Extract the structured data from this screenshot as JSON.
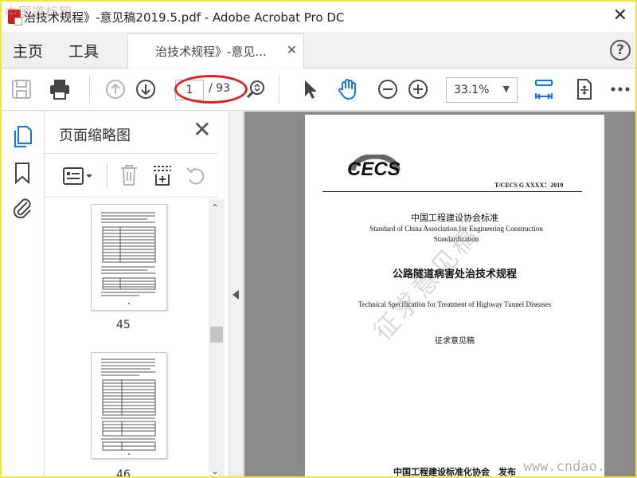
{
  "window": {
    "title": "治技术规程》-意见稿2019.5.pdf - Adobe Acrobat Pro DC",
    "close_glyph": "✕",
    "watermark_tl": "中国道标网"
  },
  "menu": {
    "home": "主页",
    "tools": "工具",
    "doc_tab_label": "治技术规程》-意见...",
    "doc_tab_close": "✕",
    "help": "?"
  },
  "toolbar": {
    "page_current": "1",
    "page_total": "/ 93",
    "zoom": "33.1%",
    "zoom_arrow": "▼"
  },
  "thumbnails": {
    "title": "页面缩略图",
    "close_glyph": "✕",
    "pages": [
      {
        "number": "45"
      },
      {
        "number": "46"
      }
    ]
  },
  "document": {
    "logo": "CECS",
    "std_number": "T/CECS G XXXX：2019",
    "cn_org": "中国工程建设协会标准",
    "en_org": "Standard of China Association for Engineering Construction Standardization",
    "cn_title": "公路隧道病害处治技术规程",
    "en_title": "Technical Specification for Treatment of Highway Tunnel Diseases",
    "draft_label": "征求意见稿",
    "stamp_watermark": "征求意见稿",
    "publisher": "中国工程建设标准化协会　发布"
  },
  "watermark_br": "www.cndao.",
  "colors": {
    "accent": "#1473e6",
    "annotation": "#e02020",
    "frame": "#f3e34a"
  },
  "icons": [
    "save-icon",
    "print-icon",
    "page-up-icon",
    "page-down-icon",
    "zoom-search-icon",
    "select-cursor-icon",
    "hand-icon",
    "zoom-out-icon",
    "zoom-in-icon",
    "fit-page-icon",
    "rotate-view-icon",
    "more-icon",
    "page-thumbnails-icon",
    "bookmark-icon",
    "attachment-icon",
    "options-icon",
    "delete-icon",
    "insert-icon",
    "undo-icon"
  ]
}
